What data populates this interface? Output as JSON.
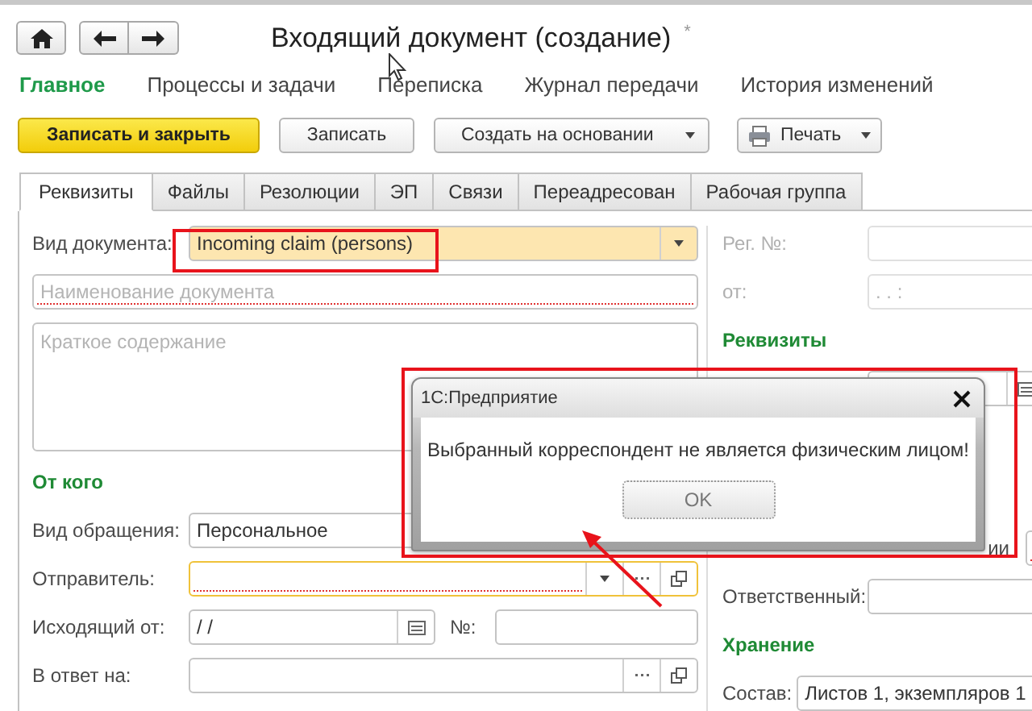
{
  "header": {
    "title": "Входящий документ (создание)",
    "modified_mark": "*"
  },
  "nav": [
    {
      "label": "Главное",
      "selected": true
    },
    {
      "label": "Процессы и задачи",
      "selected": false
    },
    {
      "label": "Переписка",
      "selected": false
    },
    {
      "label": "Журнал передачи",
      "selected": false
    },
    {
      "label": "История изменений",
      "selected": false
    }
  ],
  "toolbar": [
    {
      "label": "Записать и закрыть",
      "kind": "primary"
    },
    {
      "label": "Записать",
      "kind": "plain"
    },
    {
      "label": "Создать на основании",
      "kind": "dropdown"
    },
    {
      "label": "Печать",
      "kind": "print"
    }
  ],
  "tabs": [
    {
      "label": "Реквизиты",
      "selected": true
    },
    {
      "label": "Файлы",
      "selected": false
    },
    {
      "label": "Резолюции",
      "selected": false
    },
    {
      "label": "ЭП",
      "selected": false
    },
    {
      "label": "Связи",
      "selected": false
    },
    {
      "label": "Переадресован",
      "selected": false
    },
    {
      "label": "Рабочая группа",
      "selected": false
    }
  ],
  "left": [
    {
      "kind": "select",
      "label": "Вид документа:",
      "value": "Incoming claim (persons)",
      "highlighted": true,
      "focused": false,
      "required": false
    },
    {
      "kind": "field",
      "placeholder": "Наименование документа",
      "highlighted": false,
      "focused": false,
      "required": true
    },
    {
      "kind": "textarea",
      "placeholder": "Краткое содержание"
    },
    {
      "kind": "heading",
      "text": "От кого"
    },
    {
      "kind": "field",
      "label": "Вид обращения:",
      "value": "Персональное",
      "highlighted": false,
      "focused": false,
      "required": false
    },
    {
      "kind": "ref_select",
      "label": "Отправитель:",
      "highlighted": false,
      "focused": true,
      "required": true
    },
    {
      "kind": "date_number",
      "label": "Исходящий от:",
      "value": "/  /",
      "number_label": "№:"
    },
    {
      "kind": "ref",
      "label": "В ответ на:",
      "highlighted": false,
      "focused": false,
      "required": false
    }
  ],
  "right_top": [
    {
      "kind": "field",
      "label": "Рег. №:",
      "disabled": true
    },
    {
      "kind": "field",
      "label": "от:",
      "placeholder": ".  .     :",
      "disabled": true
    },
    {
      "kind": "heading",
      "text": "Реквизиты"
    },
    {
      "kind": "date"
    }
  ],
  "right_bottom": [
    {
      "kind": "cut_field",
      "label": "ии",
      "required": true
    },
    {
      "kind": "field",
      "label": "Ответственный:"
    },
    {
      "kind": "heading",
      "text": "Хранение"
    },
    {
      "kind": "inline_field",
      "label": "Состав:",
      "value": "Листов 1, экземпляров 1"
    }
  ],
  "dialog": {
    "title": "1С:Предприятие",
    "message": "Выбранный корреспондент не является физическим лицом!",
    "button": "OK"
  }
}
